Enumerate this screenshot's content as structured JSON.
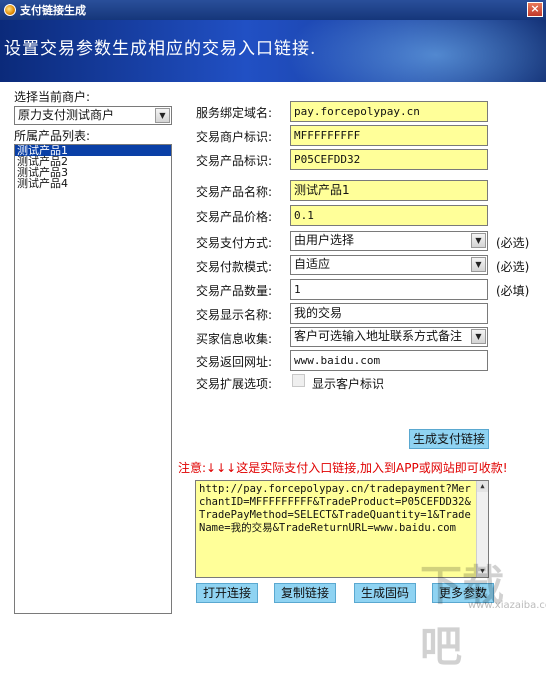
{
  "window": {
    "title": "支付链接生成",
    "close_glyph": "×"
  },
  "banner": {
    "text": "设置交易参数生成相应的交易入口链接."
  },
  "merchant": {
    "label": "选择当前商户:",
    "selected": "原力支付测试商户"
  },
  "products": {
    "label": "所属产品列表:",
    "items": [
      "测试产品1",
      "测试产品2",
      "测试产品3",
      "测试产品4"
    ]
  },
  "form": {
    "domain_label": "服务绑定域名:",
    "domain_value": "pay.forcepolypay.cn",
    "merchant_id_label": "交易商户标识:",
    "merchant_id_value": "MFFFFFFFFF",
    "product_id_label": "交易产品标识:",
    "product_id_value": "P05CEFDD32",
    "product_name_label": "交易产品名称:",
    "product_name_value": "测试产品1",
    "price_label": "交易产品价格:",
    "price_value": "0.1",
    "pay_method_label": "交易支付方式:",
    "pay_method_value": "由用户选择",
    "pay_method_req": "(必选)",
    "pay_mode_label": "交易付款模式:",
    "pay_mode_value": "自适应",
    "pay_mode_req": "(必选)",
    "quantity_label": "交易产品数量:",
    "quantity_value": "1",
    "quantity_req": "(必填)",
    "display_name_label": "交易显示名称:",
    "display_name_value": "我的交易",
    "buyer_info_label": "买家信息收集:",
    "buyer_info_value": "客户可选输入地址联系方式备注",
    "return_url_label": "交易返回网址:",
    "return_url_value": "www.baidu.com",
    "ext_label": "交易扩展选项:",
    "ext_checkbox_label": "显示客户标识"
  },
  "actions": {
    "generate": "生成支付链接",
    "notice": "注意:↓↓↓这是实际支付入口链接,加入到APP或网站即可收款!",
    "url": "http://pay.forcepolypay.cn/tradepayment?MerchantID=MFFFFFFFFF&TradeProduct=P05CEFDD32&TradePayMethod=SELECT&TradeQuantity=1&TradeName=我的交易&TradeReturnURL=www.baidu.com",
    "open": "打开连接",
    "copy": "复制链接",
    "qrcode": "生成固码",
    "more": "更多参数"
  },
  "watermark": {
    "logo": "下载吧",
    "sub": "www.xiazaiba.com"
  }
}
